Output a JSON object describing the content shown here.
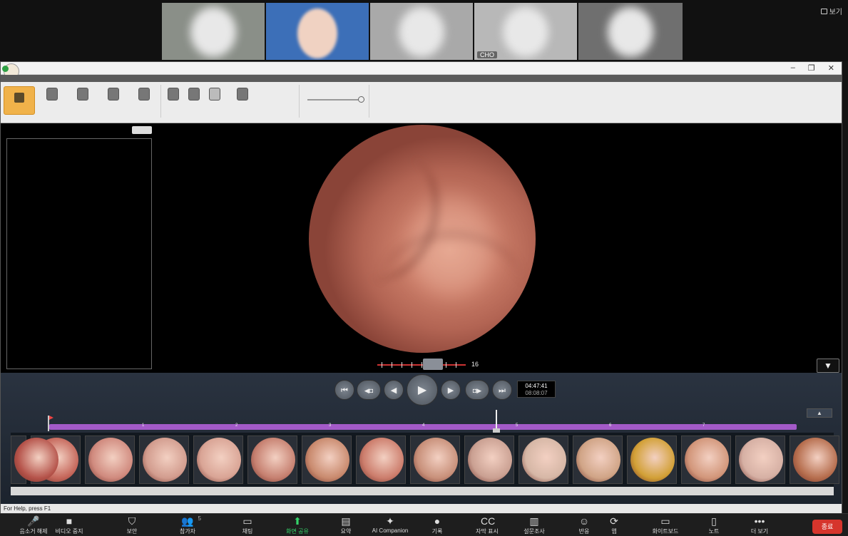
{
  "zoom_top": {
    "view_label": "보기",
    "participants": [
      {
        "name": ""
      },
      {
        "name": ""
      },
      {
        "name": ""
      },
      {
        "name": "CHO"
      },
      {
        "name": ""
      }
    ]
  },
  "app": {
    "statusbar": "For Help, press F1",
    "speed_value": "16",
    "time_main": "04:47:41",
    "time_sub": "08:08:07",
    "timeline_labels": [
      "1",
      "2",
      "3",
      "4",
      "5",
      "6",
      "7"
    ],
    "controls": {
      "first": "⏮",
      "capture_prev": "◀◘",
      "prev": "◀",
      "play": "▶",
      "next": "▶",
      "capture_next": "◘▶",
      "last": "⏭"
    },
    "thumb_colors": [
      "#b5534a",
      "#c5665a",
      "#d08a7e",
      "#d29c8e",
      "#d9a495",
      "#c68070",
      "#c98a6e",
      "#cc7d6c",
      "#c8907a",
      "#caa092",
      "#d6b7a6",
      "#d0a486",
      "#d2a036",
      "#d2967a",
      "#d6b0a4",
      "#b66e4e"
    ]
  },
  "zoom_bar": {
    "items": [
      {
        "label": "음소거 해제",
        "icon": "🎤"
      },
      {
        "label": "비디오 중지",
        "icon": "■"
      },
      {
        "label": "보안",
        "icon": "⛉"
      },
      {
        "label": "참가자",
        "icon": "👥",
        "badge": "5"
      },
      {
        "label": "채팅",
        "icon": "▭"
      },
      {
        "label": "화면 공유",
        "icon": "⬆"
      },
      {
        "label": "요약",
        "icon": "▤"
      },
      {
        "label": "AI Companion",
        "icon": "✦"
      },
      {
        "label": "기록",
        "icon": "●"
      },
      {
        "label": "자막 표시",
        "icon": "CC"
      },
      {
        "label": "설문조사",
        "icon": "▥"
      },
      {
        "label": "반응",
        "icon": "☺"
      },
      {
        "label": "앱",
        "icon": "⟳"
      },
      {
        "label": "화이트보드",
        "icon": "▭"
      },
      {
        "label": "노트",
        "icon": "▯"
      },
      {
        "label": "더 보기",
        "icon": "•••"
      }
    ],
    "end_label": "종료"
  }
}
